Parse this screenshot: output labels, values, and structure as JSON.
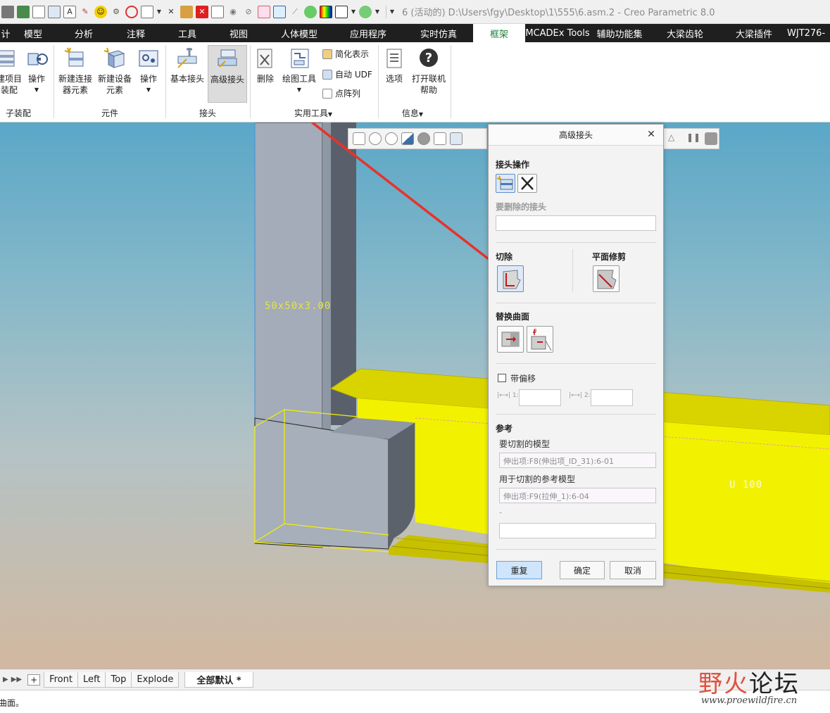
{
  "window": {
    "title": "6 (活动的) D:\\Users\\fgy\\Desktop\\1\\555\\6.asm.2 - Creo Parametric 8.0"
  },
  "tabs": [
    "计",
    "模型",
    "分析",
    "注释",
    "工具",
    "视图",
    "人体模型",
    "应用程序",
    "实时仿真",
    "框架",
    "MCADEx Tools",
    "辅助功能集",
    "大梁齿轮",
    "大梁插件",
    "WJT276-"
  ],
  "active_tab": "框架",
  "ribbon": {
    "groups": {
      "sub_assembly": "子装配",
      "components": "元件",
      "joints": "接头",
      "utilities": "实用工具",
      "info": "信息"
    },
    "buttons": {
      "new_project": "建项目",
      "new_project_2": "装配",
      "operations": "操作",
      "new_connector": "新建连接",
      "new_connector_2": "器元素",
      "new_device": "新建设备",
      "new_device_2": "元素",
      "operations2": "操作",
      "basic_joint": "基本接头",
      "advanced_joint": "高级接头",
      "delete": "删除",
      "drawing_tools": "绘图工具",
      "simplified_rep": "简化表示",
      "auto_udf": "自动 UDF",
      "point_pattern": "点阵列",
      "options": "选项",
      "open_help": "打开联机",
      "open_help_2": "帮助"
    }
  },
  "viewport": {
    "dim_label_1": "50x50x3.00",
    "dim_label_2": "U 100"
  },
  "dialog": {
    "title": "高级接头",
    "joint_ops_label": "接头操作",
    "joint_to_delete_label": "要删除的接头",
    "joint_to_delete_value": "",
    "cut_label": "切除",
    "plane_trim_label": "平面修剪",
    "replace_surface_label": "替换曲面",
    "offset_label": "带偏移",
    "offset_1_value": "",
    "offset_2_value": "",
    "reference_label": "参考",
    "model_to_cut_label": "要切割的模型",
    "model_to_cut_value": "伸出项:F8(伸出项_ID_31):6-01",
    "ref_model_label": "用于切割的参考模型",
    "ref_model_value": "伸出项:F9(拉伸_1):6-04",
    "extra_label": "-",
    "extra_value": "",
    "buttons": {
      "repeat": "重复",
      "ok": "确定",
      "cancel": "取消"
    }
  },
  "view_tabs": [
    "Front",
    "Left",
    "Top",
    "Explode"
  ],
  "active_view_tab": "全部默认 *",
  "status_text": "曲面。",
  "watermark": {
    "brand_1": "野火",
    "brand_2": "论坛",
    "url": "www.proewildfire.cn"
  },
  "colors": {
    "highlight_yellow": "#f2f200",
    "arrow_red": "#e8322b",
    "active_tab_green": "#1a7f37"
  }
}
